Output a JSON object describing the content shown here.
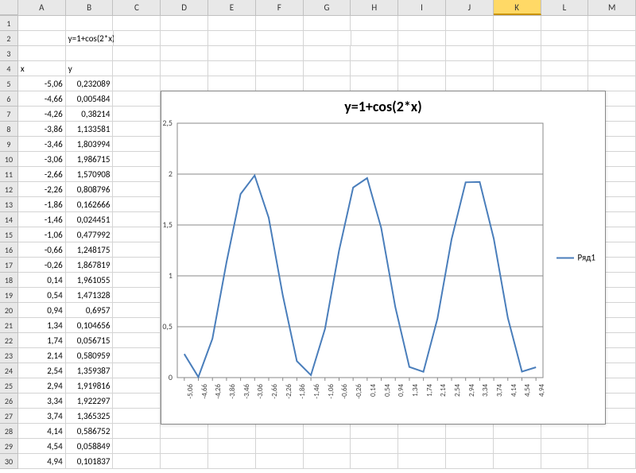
{
  "columns": [
    "A",
    "B",
    "C",
    "D",
    "E",
    "F",
    "G",
    "H",
    "I",
    "J",
    "K",
    "L",
    "M"
  ],
  "selected_col": "K",
  "formula_label": "y=1+cos(2*x)",
  "x_header": "x",
  "y_header": "y",
  "table": [
    {
      "r": 5,
      "x": "-5,06",
      "y": "0,232089"
    },
    {
      "r": 6,
      "x": "-4,66",
      "y": "0,005484"
    },
    {
      "r": 7,
      "x": "-4,26",
      "y": "0,38214"
    },
    {
      "r": 8,
      "x": "-3,86",
      "y": "1,133581"
    },
    {
      "r": 9,
      "x": "-3,46",
      "y": "1,803994"
    },
    {
      "r": 10,
      "x": "-3,06",
      "y": "1,986715"
    },
    {
      "r": 11,
      "x": "-2,66",
      "y": "1,570908"
    },
    {
      "r": 12,
      "x": "-2,26",
      "y": "0,808796"
    },
    {
      "r": 13,
      "x": "-1,86",
      "y": "0,162666"
    },
    {
      "r": 14,
      "x": "-1,46",
      "y": "0,024451"
    },
    {
      "r": 15,
      "x": "-1,06",
      "y": "0,477992"
    },
    {
      "r": 16,
      "x": "-0,66",
      "y": "1,248175"
    },
    {
      "r": 17,
      "x": "-0,26",
      "y": "1,867819"
    },
    {
      "r": 18,
      "x": "0,14",
      "y": "1,961055"
    },
    {
      "r": 19,
      "x": "0,54",
      "y": "1,471328"
    },
    {
      "r": 20,
      "x": "0,94",
      "y": "0,6957"
    },
    {
      "r": 21,
      "x": "1,34",
      "y": "0,104656"
    },
    {
      "r": 22,
      "x": "1,74",
      "y": "0,056715"
    },
    {
      "r": 23,
      "x": "2,14",
      "y": "0,580959"
    },
    {
      "r": 24,
      "x": "2,54",
      "y": "1,359387"
    },
    {
      "r": 25,
      "x": "2,94",
      "y": "1,919816"
    },
    {
      "r": 26,
      "x": "3,34",
      "y": "1,922297"
    },
    {
      "r": 27,
      "x": "3,74",
      "y": "1,365325"
    },
    {
      "r": 28,
      "x": "4,14",
      "y": "0,586752"
    },
    {
      "r": 29,
      "x": "4,54",
      "y": "0,058849"
    },
    {
      "r": 30,
      "x": "4,94",
      "y": "0,101837"
    }
  ],
  "chart_title": "y=1+cos(2*x)",
  "legend_label": "Ряд1",
  "chart_data": {
    "type": "line",
    "title": "y=1+cos(2*x)",
    "xlabel": "",
    "ylabel": "",
    "ylim": [
      0,
      2.5
    ],
    "yticks": [
      0,
      0.5,
      1,
      1.5,
      2,
      2.5
    ],
    "ytick_labels": [
      "0",
      "0,5",
      "1",
      "1,5",
      "2",
      "2,5"
    ],
    "categories": [
      "-5,06",
      "-4,66",
      "-4,26",
      "-3,86",
      "-3,46",
      "-3,06",
      "-2,66",
      "-2,26",
      "-1,86",
      "-1,46",
      "-1,06",
      "-0,66",
      "-0,26",
      "0,14",
      "0,54",
      "0,94",
      "1,34",
      "1,74",
      "2,14",
      "2,54",
      "2,94",
      "3,34",
      "3,74",
      "4,14",
      "4,54",
      "4,94"
    ],
    "series": [
      {
        "name": "Ряд1",
        "values": [
          0.232089,
          0.005484,
          0.38214,
          1.133581,
          1.803994,
          1.986715,
          1.570908,
          0.808796,
          0.162666,
          0.024451,
          0.477992,
          1.248175,
          1.867819,
          1.961055,
          1.471328,
          0.6957,
          0.104656,
          0.056715,
          0.580959,
          1.359387,
          1.919816,
          1.922297,
          1.365325,
          0.586752,
          0.058849,
          0.101837
        ]
      }
    ]
  }
}
